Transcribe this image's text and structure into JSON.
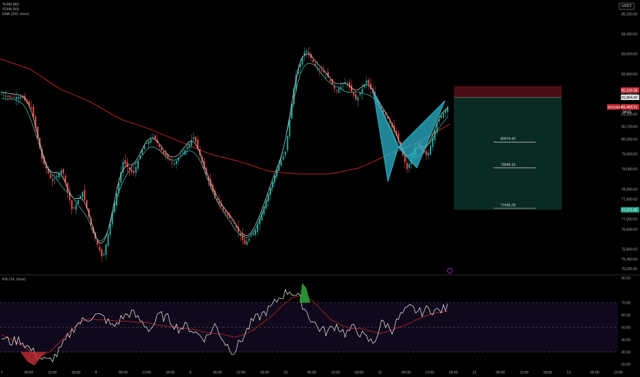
{
  "indicators": [
    "TEMA (80)",
    "TEMA (50)",
    "SMA (200, close)"
  ],
  "currency_button": "USDT",
  "rsi_label": "RSI (14, close)",
  "colors": {
    "up": "#26a69a",
    "down": "#ef5350",
    "sma": "#c62828",
    "tema1": "#e0e0e0",
    "tema2": "#4dd0c5",
    "harmonic": "#2bb3c9",
    "rsi": "#ffffff",
    "rsi_ma": "#c62828",
    "target_box": "#0a2b24",
    "stop_box": "#4a0f14"
  },
  "chart_data": [
    {
      "type": "line",
      "title": "",
      "symbol": "BTCUSDT",
      "price_ticks": [
        "85,200.00",
        "84,400.00",
        "83,600.00",
        "82,800.00",
        "82,000.00",
        "81,200.00",
        "80,700.00",
        "80,200.00",
        "79,600.00",
        "79,000.00",
        "78,200.00",
        "77,800.00",
        "77,000.00",
        "76,600.00",
        "75,800.00",
        "75,400.00",
        "75,025.00"
      ],
      "time_ticks": [
        "7",
        "06:00",
        "12:00",
        "18:00",
        "8",
        "06:00",
        "12:00",
        "18:00",
        "9",
        "06:00",
        "12:00",
        "18:00",
        "10",
        "06:00",
        "12:00",
        "18:00",
        "11",
        "06:00",
        "12:00",
        "18:00",
        "12",
        "06:00",
        "12:00",
        "18:00",
        "13",
        "06:00",
        "12:00"
      ],
      "ylim": [
        74800,
        85700
      ],
      "series_close_approx": [
        82000,
        81850,
        81900,
        81400,
        79400,
        78500,
        79000,
        77300,
        78100,
        76500,
        75400,
        77300,
        79300,
        78800,
        79900,
        80300,
        79600,
        79200,
        79700,
        80300,
        79000,
        77900,
        77300,
        76800,
        76000,
        76500,
        77600,
        78800,
        79700,
        82700,
        83800,
        83100,
        82800,
        82100,
        82500,
        81750,
        82550,
        81700,
        81100,
        80300,
        79000,
        80000,
        79500,
        80900,
        81500
      ],
      "sma200_approx": [
        83400,
        83000,
        82200,
        81700,
        81000,
        80600,
        80100,
        79600,
        79300,
        78900,
        78800,
        78800,
        79050,
        79600,
        80100,
        80800
      ],
      "target_labels": [
        "80079.42",
        "79049.15",
        "77430.29"
      ],
      "price_tags": {
        "stop": "82,156.38",
        "entry": "81,864.49",
        "current": "81,483.21",
        "countdown": "04:01",
        "target": "77,371.66"
      }
    },
    {
      "type": "line",
      "name": "RSI (14, close)",
      "ticks": [
        "90.00",
        "70.00",
        "60.00",
        "50.00",
        "40.00",
        "30.00",
        "20.00"
      ],
      "ylim": [
        18,
        92
      ],
      "bands": [
        70,
        50,
        30
      ],
      "values_approx": [
        42,
        38,
        40,
        33,
        26,
        22,
        28,
        40,
        52,
        56,
        60,
        58,
        50,
        58,
        62,
        55,
        48,
        60,
        57,
        49,
        51,
        45,
        41,
        52,
        38,
        30,
        42,
        55,
        60,
        66,
        75,
        80,
        74,
        60,
        50,
        46,
        52,
        45,
        50,
        42,
        37,
        55,
        48,
        60,
        66,
        62,
        65,
        63,
        66
      ],
      "ma_approx": [
        44,
        40,
        36,
        30,
        27,
        30,
        38,
        46,
        54,
        57,
        56,
        56,
        55,
        55,
        54,
        54,
        52,
        51,
        50,
        49,
        48,
        46,
        45,
        44,
        42,
        44,
        48,
        54,
        60,
        68,
        74,
        76,
        72,
        64,
        56,
        52,
        49,
        49,
        47,
        45,
        47,
        50,
        53,
        57,
        60,
        62,
        63
      ]
    }
  ]
}
